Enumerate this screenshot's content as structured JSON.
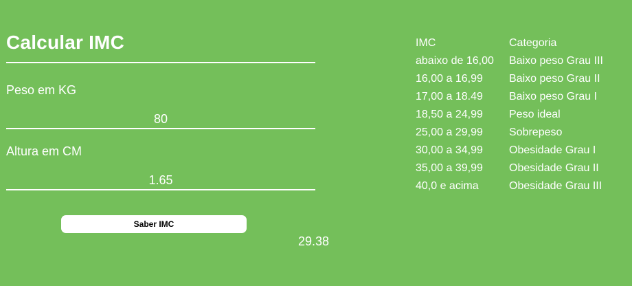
{
  "form": {
    "title": "Calcular IMC",
    "weight_label": "Peso em KG",
    "weight_value": "80",
    "height_label": "Altura em CM",
    "height_value": "1.65",
    "button_label": "Saber IMC",
    "result": "29.38"
  },
  "table": {
    "headers": [
      "IMC",
      "Categoria"
    ],
    "rows": [
      [
        "abaixo de 16,00",
        "Baixo peso Grau III"
      ],
      [
        "16,00 a 16,99",
        "Baixo peso Grau II"
      ],
      [
        "17,00 a 18.49",
        "Baixo peso Grau I"
      ],
      [
        "18,50 a 24,99",
        "Peso ideal"
      ],
      [
        "25,00 a 29,99",
        "Sobrepeso"
      ],
      [
        "30,00 a 34,99",
        "Obesidade Grau I"
      ],
      [
        "35,00 a 39,99",
        "Obesidade Grau II"
      ],
      [
        "40,0 e acima",
        "Obesidade Grau III"
      ]
    ]
  },
  "colors": {
    "background": "#74bf5a",
    "text": "#ffffff",
    "button_background": "#ffffff",
    "button_text": "#000000"
  }
}
